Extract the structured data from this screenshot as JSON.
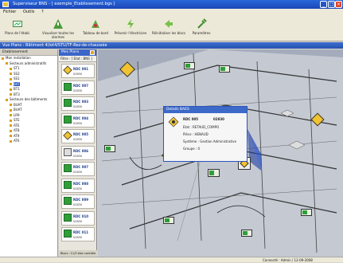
{
  "window": {
    "title": "Superviseur BNS - [ exemple_Etablissement.bgs ]",
    "controls": [
      "_",
      "□",
      "×"
    ]
  },
  "menu": [
    "Fichier",
    "Outils",
    "?"
  ],
  "toolbar": [
    {
      "label": "Plans de l'établ.",
      "icon": "plan-icon"
    },
    {
      "label": "Visualiser toutes les alarmes",
      "icon": "alarm-icon"
    },
    {
      "label": "Tableau de bord",
      "icon": "dashboard-icon"
    },
    {
      "label": "Prévenir l'électricien",
      "icon": "electrician-icon"
    },
    {
      "label": "Réinitialiser les blocs",
      "icon": "reset-icon"
    },
    {
      "label": "Paramètres",
      "icon": "settings-icon"
    }
  ],
  "map_header": "Vue Plans : Bâtiment 4(lot4/STU/TF-Rez-de-chaussée",
  "tree": {
    "header": "Etablissement",
    "items": [
      {
        "label": "Mon installation",
        "level": 0
      },
      {
        "label": "Secteurs administratifs",
        "level": 1
      },
      {
        "label": "ST1",
        "level": 2
      },
      {
        "label": "SS2",
        "level": 2
      },
      {
        "label": "SS1",
        "level": 2
      },
      {
        "label": "BAT",
        "level": 2,
        "selected": true
      },
      {
        "label": "BT1",
        "level": 2
      },
      {
        "label": "BT3",
        "level": 2
      },
      {
        "label": "Secteurs des bâtiments",
        "level": 1
      },
      {
        "label": "BUAT",
        "level": 2
      },
      {
        "label": "BUAT",
        "level": 2
      },
      {
        "label": "LR9",
        "level": 2
      },
      {
        "label": "STE",
        "level": 2
      },
      {
        "label": "ATE",
        "level": 2
      },
      {
        "label": "AT8",
        "level": 2
      },
      {
        "label": "AT9",
        "level": 2
      },
      {
        "label": "AT6",
        "level": 2
      }
    ]
  },
  "plans_panel": {
    "header": "Mes Plans",
    "filter": "Filtre : [ Etat : BNS ]",
    "cards": [
      {
        "name": "RDC 001",
        "code": "02830",
        "icon": "warning-icon"
      },
      {
        "name": "RDC 007",
        "code": "02830",
        "icon": "exit-sign-icon"
      },
      {
        "name": "RDC 003",
        "code": "02830",
        "icon": "exit-sign-icon"
      },
      {
        "name": "RDC 004",
        "code": "02830",
        "icon": "exit-sign-icon"
      },
      {
        "name": "RDC 005",
        "code": "02830",
        "icon": "warning-icon"
      },
      {
        "name": "RDC 006",
        "code": "02830",
        "icon": "device-icon"
      },
      {
        "name": "RDC 007",
        "code": "02830",
        "icon": "exit-sign-icon"
      },
      {
        "name": "RDC 008",
        "code": "02830",
        "icon": "exit-sign-icon"
      },
      {
        "name": "RDC 009",
        "code": "02830",
        "icon": "exit-sign-icon"
      },
      {
        "name": "RDC 010",
        "code": "02830",
        "icon": "exit-sign-icon"
      },
      {
        "name": "RDC 011",
        "code": "02830",
        "icon": "exit-sign-icon"
      }
    ],
    "footer": "Blocs : 11/3 bloc contrôle 98"
  },
  "popup": {
    "title": "Details BAES",
    "name": "RDC 005",
    "code": "02830",
    "etat": "Etat : RETAUD_COMPO",
    "piece": "Pièce : HENAUD",
    "systeme": "Système : Gestion Administrative",
    "groupe": "Groupe : 0"
  },
  "status": {
    "left": "",
    "right": "Connecté : Admin / 12-09-2008"
  }
}
